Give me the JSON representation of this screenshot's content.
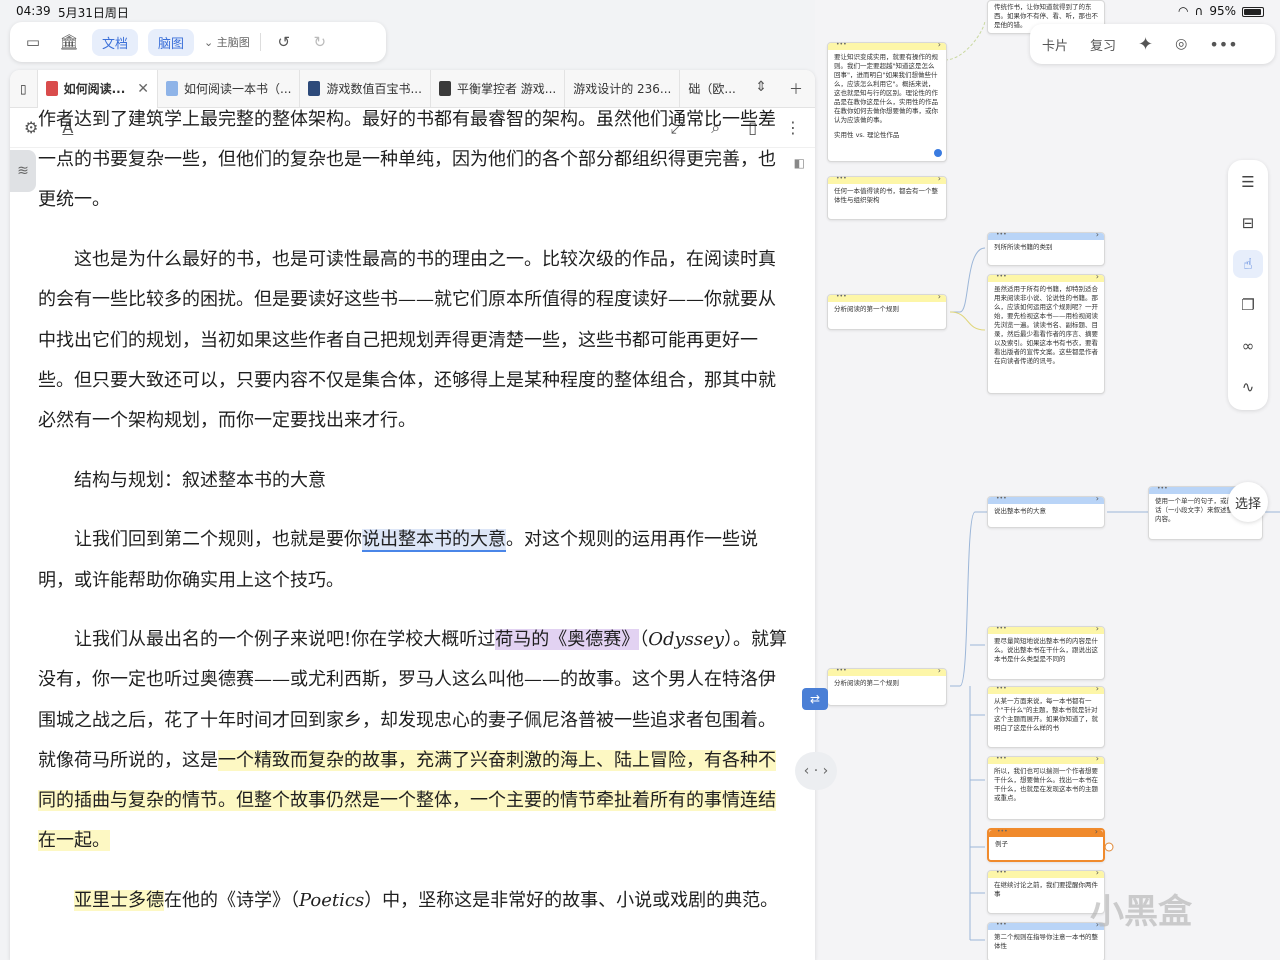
{
  "status": {
    "time": "04:39",
    "date": "5月31日周日",
    "battery": "95%"
  },
  "toolbar": {
    "doc_label": "文档",
    "mindmap_label": "脑图",
    "main_mindmap_label": "主脑图"
  },
  "right_toolbar": {
    "cards_label": "卡片",
    "review_label": "复习"
  },
  "select_label": "选择",
  "tabs": [
    {
      "label": "如何阅读..."
    },
    {
      "label": "如何阅读一本书（..."
    },
    {
      "label": "游戏数值百宝书..."
    },
    {
      "label": "平衡掌控者 游戏..."
    },
    {
      "label": "游戏设计的 236..."
    },
    {
      "label": "础（欧..."
    }
  ],
  "content": {
    "p0": "作者达到了建筑学上最完整的整体架构。最好的书都有最睿智的架构。虽然他们通常比一些差一点的书要复杂一些，但他们的复杂也是一种单纯，因为他们的各个部分都组织得更完善，也更统一。",
    "p1": "这也是为什么最好的书，也是可读性最高的书的理由之一。比较次级的作品，在阅读时真的会有一些比较多的困扰。但是要读好这些书——就它们原本所值得的程度读好——你就要从中找出它们的规划，当初如果这些作者自己把规划弄得更清楚一些，这些书都可能再更好一些。但只要大致还可以，只要内容不仅是集合体，还够得上是某种程度的整体组合，那其中就必然有一个架构规划，而你一定要找出来才行。",
    "heading": "结构与规划：叙述整本书的大意",
    "p2_a": "让我们回到第二个规则，也就是要你",
    "p2_hl": "说出整本书的大意",
    "p2_b": "。对这个规则的运用再作一些说明，或许能帮助你确实用上这个技巧。",
    "p3_a": "让我们从最出名的一个例子来说吧!你在学校大概听过",
    "p3_hl": "荷马的《奥德赛》",
    "p3_paren_open": "（",
    "p3_ital": "Odyssey",
    "p3_b": "）。就算没有，你一定也听过奥德赛——或尤利西斯，罗马人这么叫他——的故事。这个男人在特洛伊围城之战之后，花了十年时间才回到家乡，却发现忠心的妻子佩尼洛普被一些追求者包围着。就像荷马所说的，这是",
    "p3_hl2": "一个精致而复杂的故事，充满了兴奋刺激的海上、陆上冒险，有各种不同的插曲与复杂的情节。但整个故事仍然是一个整体，一个主要的情节牵扯着所有的事情连结在一起。",
    "p4_hl": "亚里士多德",
    "p4_a": "在他的《诗学》（",
    "p4_ital": "Poetics",
    "p4_b": "）中，坚称这是非常好的故事、小说或戏剧的典范。"
  },
  "mindmap": {
    "n_top_right": "传统作书，让你知道就得到了的东西。如果你不有停、看、听，那也不是他的错。",
    "n1": "要让知识变成实用，就要有操作的规则。我们一定要超越\"知道这是怎么回事\"，进而明白\"如果我们想做些什么，应该怎么利用它\"。概括来说，这也就是知与行的区别。理论性的作品是在教你这是什么，实用性的作品在教你如何去做你想要做的事，或你认为应该做的事。",
    "n1_tag": "实用性 vs. 理论性作品",
    "n2": "任何一本值得读的书，都会有一个整体性与组织架构",
    "n3": "分析阅读的第一个规则",
    "n4": "列所所读书籍的类别",
    "n5": "虽然适用于所有的书籍，却特别适合用来阅读非小说、论说性的书籍。那么，应该如何运用这个规则呢？一开始，要先检视这本书——用检视阅读先浏览一遍。读读书名、副标题、目录，然后最少看看作者的序言、摘要以及索引。如果这本书有书衣，要看看出版者的宣传文案。这些都是作者在向读者传递的讯号。",
    "n6": "说出整本书的大意",
    "n7": "使用一个单一的句子，或最多几句话（一小段文字）来叙述整本书的内容。",
    "n8": "分析阅读的第二个规则",
    "n9": "要尽量简短地说出整本书的内容是什么。说出整本书在干什么，跟说出这本书是什么类型是不同的",
    "n10": "从某一方面来说，每一本书都有一个\"干什么\"的主题，整本书就是针对这个主题而展开。如果你知道了，就明白了这是什么样的书",
    "n11": "所以，我们也可以揣测一个作者想要干什么，想要做什么。找出一本书在干什么，也就是在发现这本书的主题或重点。",
    "n12": "例子",
    "n13": "在继续讨论之前，我们要提醒你两件事",
    "n14": "第二个规则在指导你注意一本书的整体性"
  },
  "watermark": "小黑盒"
}
